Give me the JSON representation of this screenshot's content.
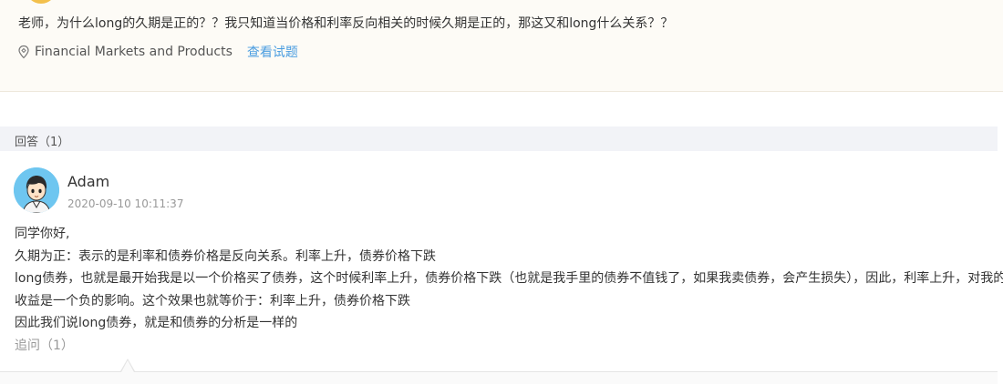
{
  "question": {
    "text": "老师，为什么long的久期是正的？？我只知道当价格和利率反向相关的时候久期是正的，那这又和long什么关系？？",
    "topic": "Financial Markets and Products",
    "view_question_label": "查看试题"
  },
  "answers_section": {
    "header_label": "回答（1）"
  },
  "answer": {
    "author": "Adam",
    "timestamp": "2020-09-10 10:11:37",
    "paragraphs": [
      "同学你好,",
      "久期为正：表示的是利率和债券价格是反向关系。利率上升，债券价格下跌",
      "long债券，也就是最开始我是以一个价格买了债券，这个时候利率上升，债券价格下跌（也就是我手里的债券不值钱了，如果我卖债券，会产生损失），因此，利率上升，对我的",
      "收益是一个负的影响。这个效果也就等价于：利率上升，债券价格下跌",
      "因此我们说long债券，就是和债券的分析是一样的"
    ],
    "followup_label": "追问（1）"
  },
  "colors": {
    "link_blue": "#4a9de0",
    "question_bg": "#fdfbf6",
    "section_header_bg": "#f2f3f7",
    "muted_text": "#999999"
  },
  "icons": {
    "topic": "location-tag-icon",
    "asker_avatar": "user-avatar",
    "answerer_avatar": "cartoon-boy-avatar"
  }
}
